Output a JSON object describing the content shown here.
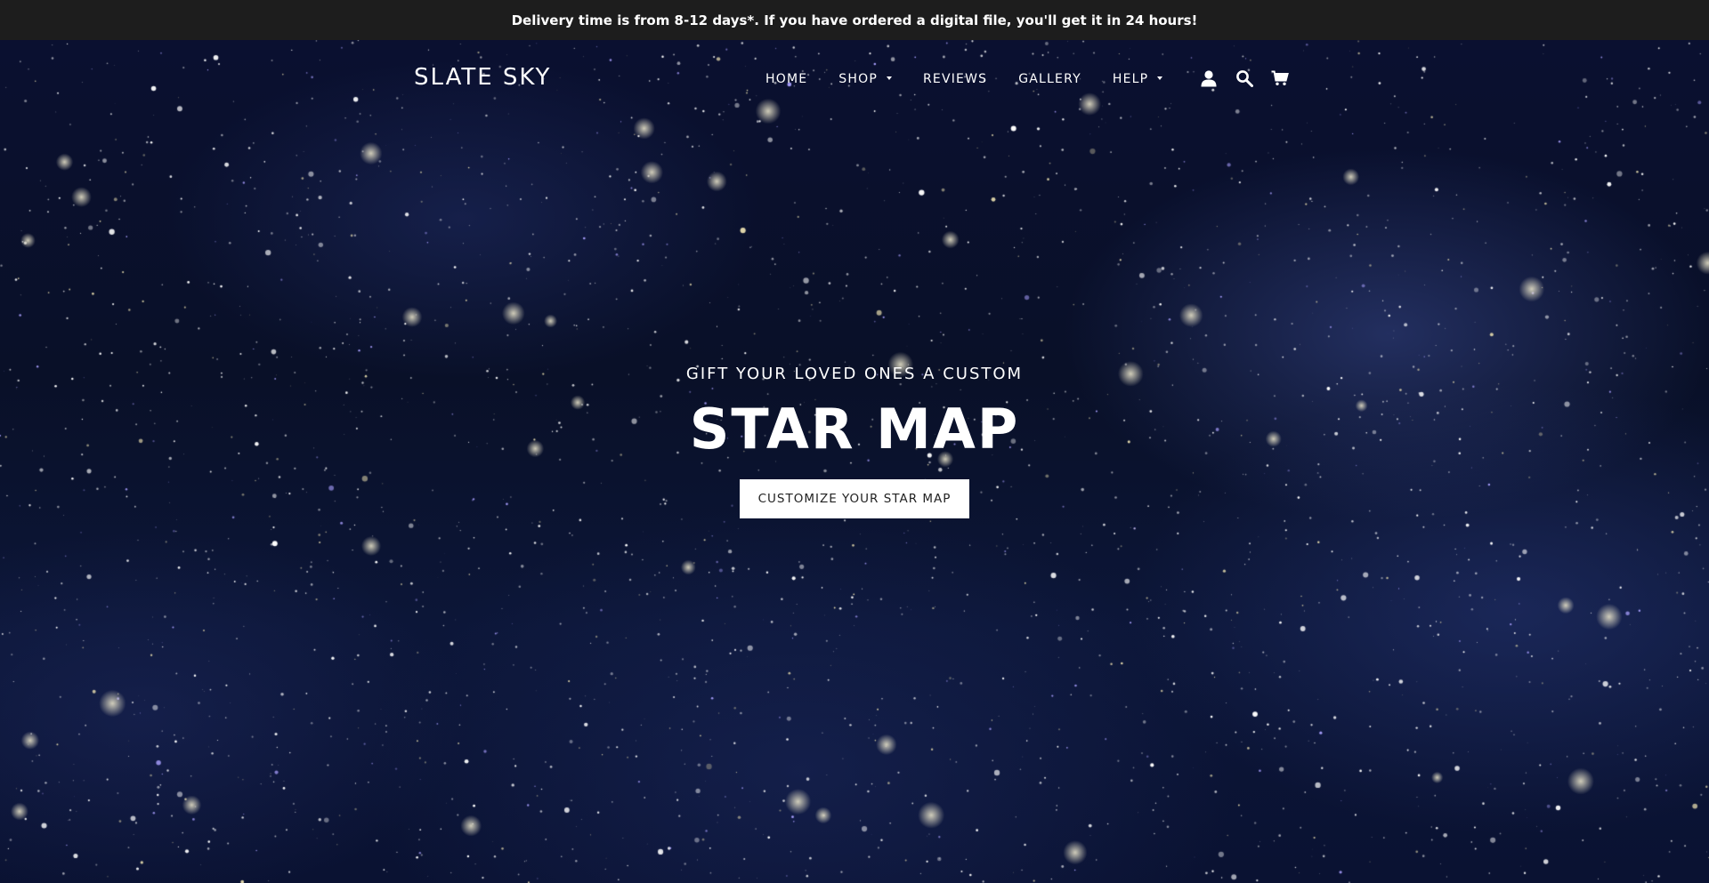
{
  "announcement": {
    "text": "Delivery time is from 8-12 days*. If you have ordered a digital file, you'll get it in 24 hours!"
  },
  "header": {
    "logo": "SLATE SKY",
    "nav": [
      {
        "label": "HOME",
        "dropdown": false
      },
      {
        "label": "SHOP",
        "dropdown": true
      },
      {
        "label": "REVIEWS",
        "dropdown": false
      },
      {
        "label": "GALLERY",
        "dropdown": false
      },
      {
        "label": "HELP",
        "dropdown": true
      }
    ],
    "icons": [
      "account-icon",
      "search-icon",
      "cart-icon"
    ]
  },
  "hero": {
    "eyebrow": "GIFT YOUR LOVED ONES A CUSTOM",
    "headline": "STAR MAP",
    "cta_label": "CUSTOMIZE YOUR STAR MAP"
  },
  "colors": {
    "announcement_bg": "#1d1d1d",
    "hero_bg": "#0a1030",
    "text": "#ffffff",
    "button_bg": "#ffffff",
    "button_text": "#222222"
  }
}
